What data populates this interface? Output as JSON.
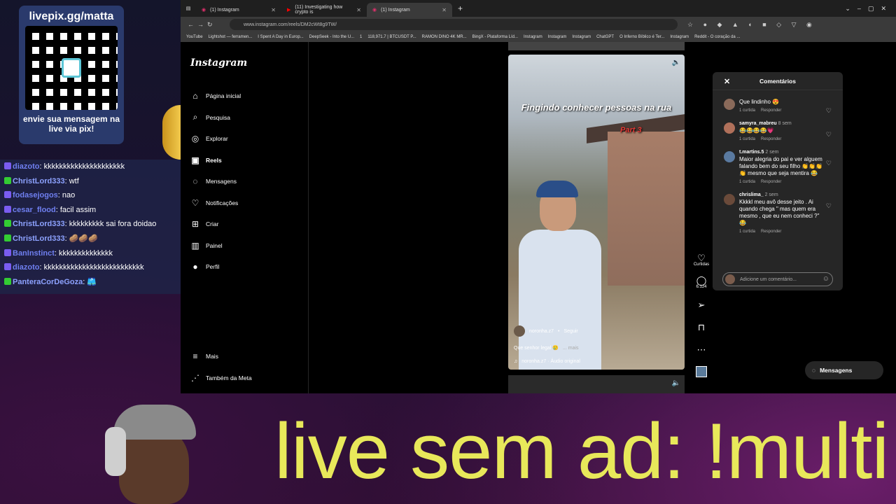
{
  "overlay": {
    "qr_title": "livepix.gg/matta",
    "qr_caption": "envie sua mensagem na live via pix!",
    "big_text": "live sem ad: !multi"
  },
  "chat": [
    {
      "user": "diazoto",
      "msg": "kkkkkkkkkkkkkkkkkkkkk",
      "color": "#6f7ff0",
      "badge": "#7a5cf0"
    },
    {
      "user": "ChristLord333",
      "msg": "wtf",
      "color": "#8da2ff",
      "badge": "#33cc33"
    },
    {
      "user": "fodasejogos",
      "msg": "nao",
      "color": "#6f7ff0",
      "badge": "#7a5cf0"
    },
    {
      "user": "cesar_flood",
      "msg": "facil assim",
      "color": "#6f7ff0",
      "badge": "#7a5cf0"
    },
    {
      "user": "ChristLord333",
      "msg": "kkkkkkkkk sai fora doidao",
      "color": "#8da2ff",
      "badge": "#33cc33"
    },
    {
      "user": "ChristLord333",
      "msg": "🥔🥔🥔",
      "color": "#8da2ff",
      "badge": "#33cc33"
    },
    {
      "user": "BanInstinct",
      "msg": "kkkkkkkkkkkkkk",
      "color": "#6f7ff0",
      "badge": "#7a5cf0"
    },
    {
      "user": "diazoto",
      "msg": "kkkkkkkkkkkkkkkkkkkkkkkkkk",
      "color": "#6f7ff0",
      "badge": "#7a5cf0"
    },
    {
      "user": "PanteraCorDeGoza",
      "msg": "🩳",
      "color": "#8da2ff",
      "badge": "#33cc33"
    }
  ],
  "browser": {
    "tabs": [
      {
        "label": "(1) Instagram"
      },
      {
        "label": "(11) Investigating how crypto is"
      },
      {
        "label": "(1) Instagram"
      }
    ],
    "url": "www.instagram.com/reels/DM2cWt8g9TW/",
    "bookmarks": [
      "YouTube",
      "Lightshot — ferramen...",
      "I Spent A Day in Europ...",
      "DeepSeek - Into the U...",
      "1",
      "118,971.7 | BTCUSDT P...",
      "RAMON DINO 4K MR...",
      "BingX - Plataforma Líd...",
      "Instagram",
      "Instagram",
      "Instagram",
      "ChatGPT",
      "O Inferno Bíblico é Ter...",
      "Instagram",
      "Reddit - O coração da ..."
    ]
  },
  "instagram": {
    "logo": "Instagram",
    "nav": [
      {
        "label": "Página inicial",
        "icon": "home-icon",
        "glyph": "⌂"
      },
      {
        "label": "Pesquisa",
        "icon": "search-icon",
        "glyph": "⌕"
      },
      {
        "label": "Explorar",
        "icon": "compass-icon",
        "glyph": "◎"
      },
      {
        "label": "Reels",
        "icon": "reels-icon",
        "glyph": "▣"
      },
      {
        "label": "Mensagens",
        "icon": "messenger-icon",
        "glyph": "◌"
      },
      {
        "label": "Notificações",
        "icon": "heart-icon",
        "glyph": "♡"
      },
      {
        "label": "Criar",
        "icon": "plus-icon",
        "glyph": "⊞"
      },
      {
        "label": "Painel",
        "icon": "dashboard-icon",
        "glyph": "▥"
      },
      {
        "label": "Perfil",
        "icon": "avatar-icon",
        "glyph": "●"
      }
    ],
    "nav_bottom": [
      {
        "label": "Mais",
        "icon": "menu-icon",
        "glyph": "≡"
      },
      {
        "label": "Também da Meta",
        "icon": "meta-icon",
        "glyph": "⋰"
      }
    ],
    "reel": {
      "title": "Fingindo conhecer pessoas na rua",
      "part": "Part 3",
      "author": "noronha.z7",
      "follow": "Seguir",
      "caption": "Que senhor legal 🥲",
      "more": "... mais",
      "audio": "noronha.z7 · Áudio original"
    },
    "actions": {
      "likes_label": "Curtidas",
      "comments_count": "6.124"
    },
    "comments": {
      "title": "Comentários",
      "items": [
        {
          "user": "",
          "time": "",
          "text": "Que lindinho 😍",
          "likes": "1 curtida",
          "reply": "Responder",
          "avatar": "#8a6a5a"
        },
        {
          "user": "samyra_mabreu",
          "time": "8 sem",
          "text": "😂😂😂😂💗",
          "likes": "1 curtida",
          "reply": "Responder",
          "avatar": "#b0705a"
        },
        {
          "user": "t.martins.5",
          "time": "2 sem",
          "text": "Maior alegria do pai e ver alguem falando bem do seu filho 👏👏👏👏 mesmo que seja mentira 😂",
          "likes": "1 curtida",
          "reply": "Responder",
          "avatar": "#5a7aa0"
        },
        {
          "user": "chrislima_",
          "time": "2 sem",
          "text": "Kkkkl meu avô desse jeito . Ai quando chega \" mas quem era mesmo , que eu nem conheci ?\" 😂",
          "likes": "1 curtida",
          "reply": "Responder",
          "avatar": "#6a4a3a"
        }
      ],
      "input_placeholder": "Adicione um comentário..."
    },
    "messages_button": "Mensagens"
  }
}
